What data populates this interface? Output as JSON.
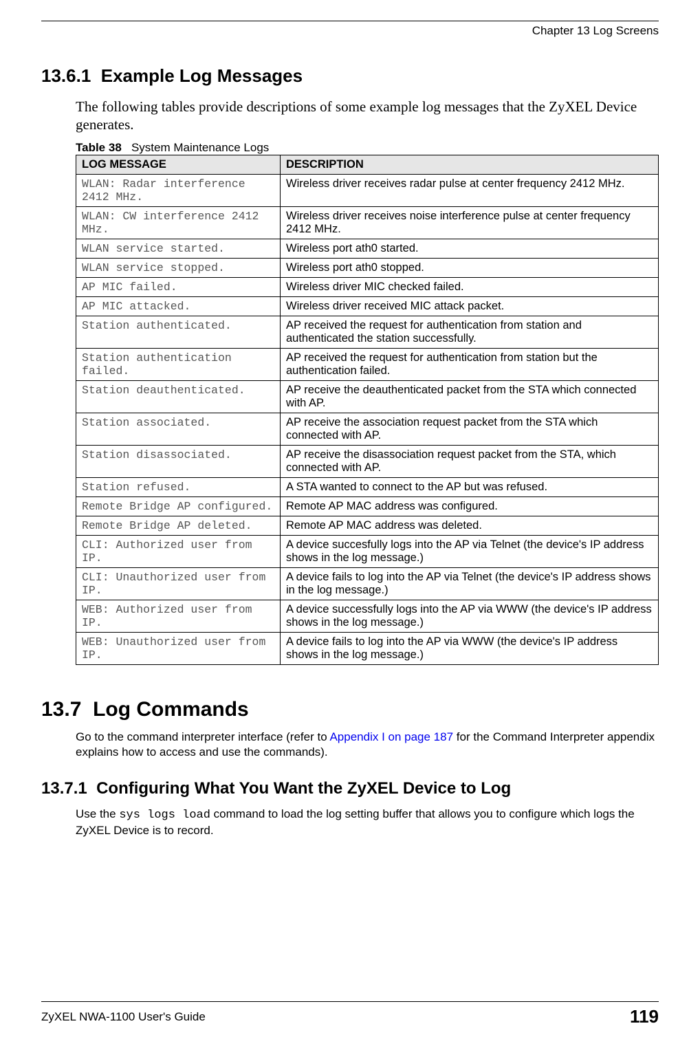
{
  "header": {
    "chapter": "Chapter 13 Log Screens"
  },
  "section1": {
    "number": "13.6.1",
    "title": "Example Log Messages",
    "intro": "The following tables provide descriptions of some example log messages that the ZyXEL Device generates."
  },
  "table": {
    "caption_label": "Table 38",
    "caption_text": "System Maintenance Logs",
    "col1": "LOG MESSAGE",
    "col2": "DESCRIPTION",
    "rows": [
      {
        "msg": "WLAN: Radar interference 2412 MHz.",
        "desc": "Wireless driver receives radar pulse at center frequency 2412 MHz."
      },
      {
        "msg": "WLAN: CW interference 2412 MHz.",
        "desc": "Wireless driver receives noise interference pulse at center frequency 2412 MHz."
      },
      {
        "msg": "WLAN service started.",
        "desc": "Wireless port ath0 started."
      },
      {
        "msg": "WLAN service stopped.",
        "desc": "Wireless port ath0 stopped."
      },
      {
        "msg": "AP MIC failed.",
        "desc": "Wireless driver MIC checked failed."
      },
      {
        "msg": "AP MIC attacked.",
        "desc": "Wireless driver received MIC attack packet."
      },
      {
        "msg": "Station authenticated.",
        "desc": "AP received the request for authentication from station and authenticated the station successfully."
      },
      {
        "msg": "Station authentication failed.",
        "desc": "AP received the request for authentication from station but the authentication failed."
      },
      {
        "msg": "Station deauthenticated.",
        "desc": "AP receive the deauthenticated packet from the STA which connected with AP."
      },
      {
        "msg": "Station associated.",
        "desc": "AP receive the association request packet from the STA which connected with AP."
      },
      {
        "msg": "Station disassociated.",
        "desc": "AP receive the disassociation request packet from the STA, which connected with AP."
      },
      {
        "msg": "Station refused.",
        "desc": "A STA wanted to connect to the AP but was refused."
      },
      {
        "msg": "Remote Bridge AP configured.",
        "desc": "Remote AP MAC address was configured."
      },
      {
        "msg": "Remote Bridge AP deleted.",
        "desc": "Remote AP MAC address was deleted."
      },
      {
        "msg": "CLI: Authorized user from IP.",
        "desc": "A device succesfully logs into the AP via Telnet  (the device's IP address shows in the log message.)"
      },
      {
        "msg": "CLI: Unauthorized user from IP.",
        "desc": "A device fails to log into the AP via Telnet  (the device's IP address shows in the log message.)"
      },
      {
        "msg": "WEB: Authorized user from IP.",
        "desc": "A device successfully logs into the AP via WWW  (the device's IP address shows in the log message.)"
      },
      {
        "msg": "WEB: Unauthorized user from IP.",
        "desc": "A device fails to log into the AP via WWW (the device's IP address shows in the log message.)"
      }
    ]
  },
  "section2": {
    "number": "13.7",
    "title": "Log Commands",
    "text_pre": "Go to the command interpreter interface (refer to ",
    "link": "Appendix I on page 187",
    "text_post": " for the Command Interpreter appendix explains how to access and use the commands)."
  },
  "section3": {
    "number": "13.7.1",
    "title": "Configuring What You Want the ZyXEL Device to Log",
    "text_pre": "Use the ",
    "code": "sys logs load",
    "text_post": " command to load the log setting buffer that allows you to configure which logs the ZyXEL Device is to record."
  },
  "footer": {
    "guide": "ZyXEL NWA-1100 User's Guide",
    "page": "119"
  }
}
